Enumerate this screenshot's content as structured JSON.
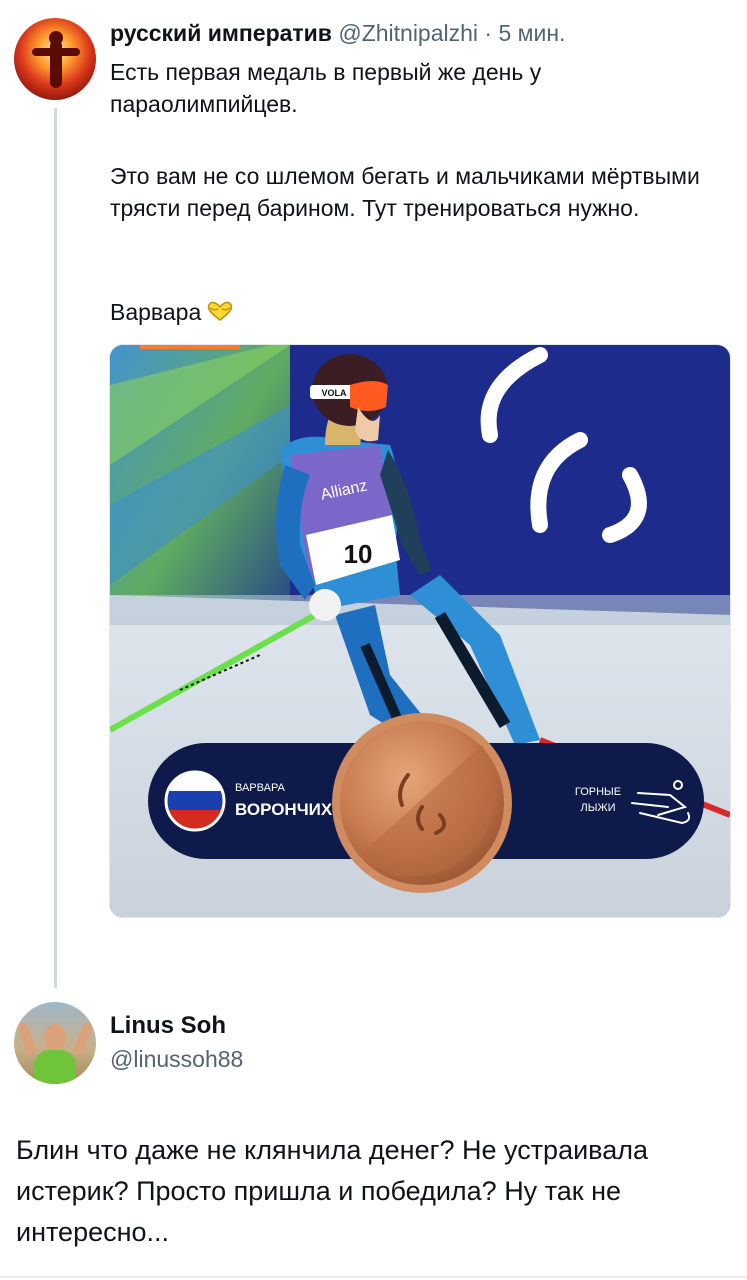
{
  "tweet1": {
    "author_name": "русский императив",
    "author_handle": "@Zhitnipalzhi",
    "separator": "·",
    "time": "5 мин.",
    "paragraph1": "Есть первая медаль в первый же день у параолимпийцев.",
    "paragraph2": "Это вам не со шлемом бегать и мальчиками мёртвыми трясти перед барином. Тут тренироваться нужно.",
    "paragraph3": "Варвара",
    "emoji": "heart-hands-icon",
    "media": {
      "helmet_text": "VOLA",
      "bib_sponsor": "Allianz",
      "bib_number": "10",
      "athlete_first_name": "ВАРВАРА",
      "athlete_last_name": "ВОРОНЧИХИНА",
      "sport_line1": "ГОРНЫЕ",
      "sport_line2": "ЛЫЖИ",
      "medal": "bronze",
      "country_flag": "russia-flag-icon",
      "colors": {
        "banner": "#0e1a4a",
        "bronze": "#c77a4e",
        "suit": "#2f8fd6"
      }
    }
  },
  "tweet2": {
    "author_name": "Linus Soh",
    "author_handle": "@linussoh88",
    "text": "Блин что даже не клянчила денег? Не устраивала истерик? Просто пришла и победила? Ну так не интересно..."
  }
}
